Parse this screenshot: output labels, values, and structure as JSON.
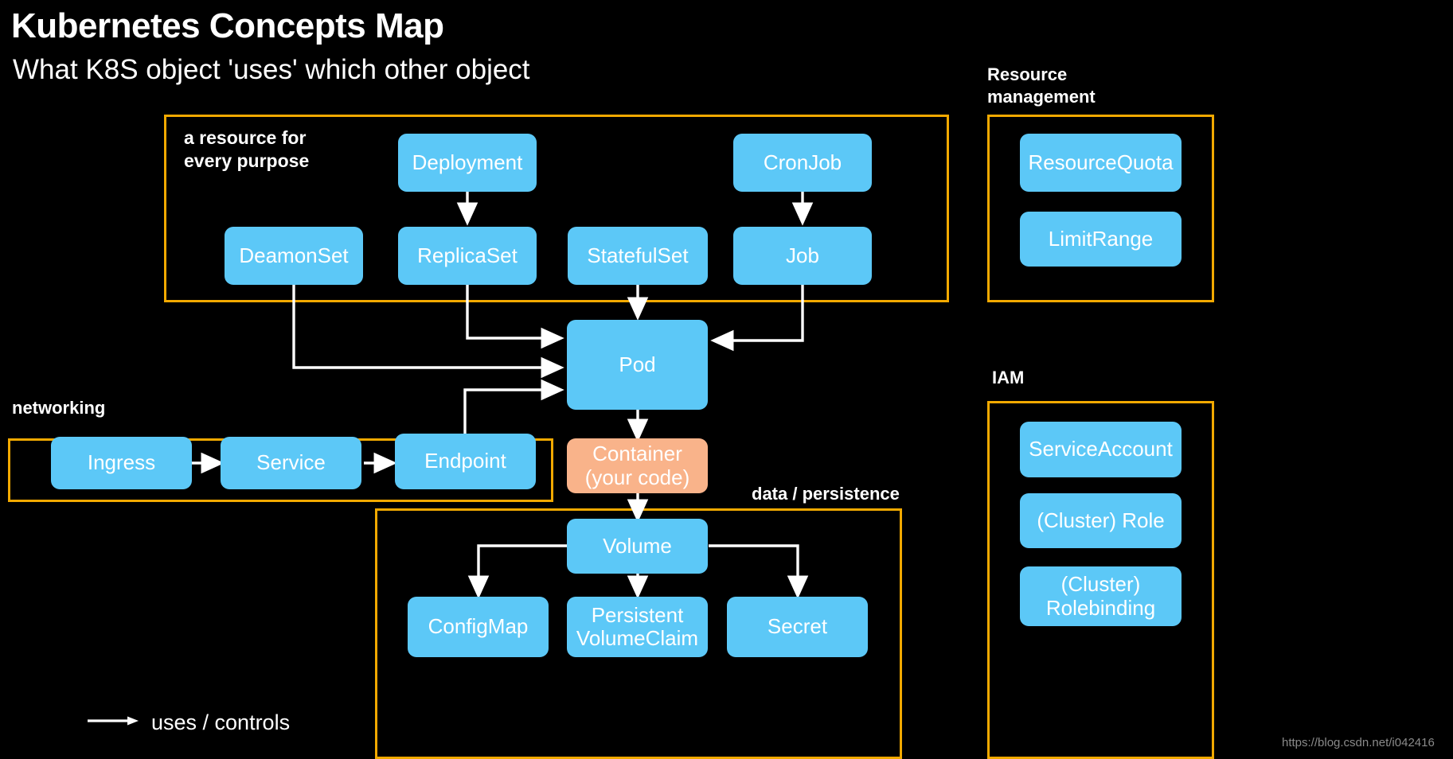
{
  "header": {
    "title": "Kubernetes Concepts Map",
    "subtitle": "What K8S object 'uses' which other object"
  },
  "groups": {
    "workloads": {
      "label": "a resource for\nevery purpose"
    },
    "networking": {
      "label": "networking"
    },
    "data": {
      "label": "data / persistence"
    },
    "resource_management": {
      "label": "Resource\nmanagement"
    },
    "iam": {
      "label": "IAM"
    }
  },
  "nodes": {
    "deployment": "Deployment",
    "cronjob": "CronJob",
    "daemonset": "DeamonSet",
    "replicaset": "ReplicaSet",
    "statefulset": "StatefulSet",
    "job": "Job",
    "pod": "Pod",
    "container": "Container\n(your code)",
    "ingress": "Ingress",
    "service": "Service",
    "endpoint": "Endpoint",
    "volume": "Volume",
    "configmap": "ConfigMap",
    "pvc": "Persistent\nVolumeClaim",
    "secret": "Secret",
    "resourcequota": "ResourceQuota",
    "limitrange": "LimitRange",
    "serviceaccount": "ServiceAccount",
    "cluster_role": "(Cluster) Role",
    "cluster_rolebinding": "(Cluster)\nRolebinding"
  },
  "legend": {
    "text": "uses / controls"
  },
  "watermark": {
    "text": "https://blog.csdn.net/i042416"
  },
  "colors": {
    "background": "#000000",
    "node_blue": "#5cc8f7",
    "node_orange": "#f9b38a",
    "group_outline": "#f2a900",
    "text": "#ffffff",
    "arrow": "#ffffff"
  }
}
